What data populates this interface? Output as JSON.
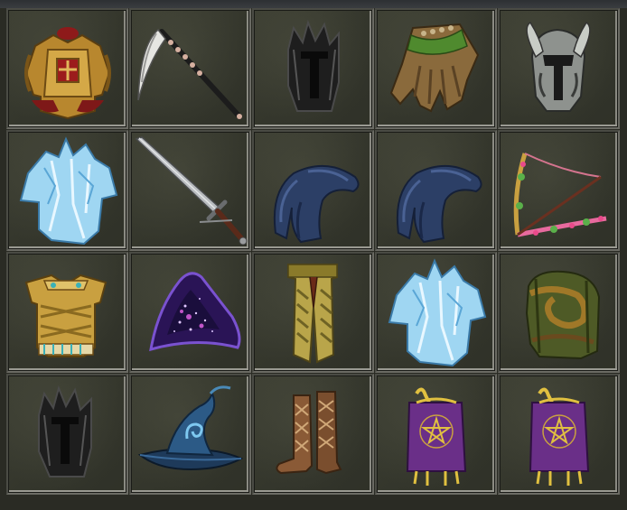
{
  "inventory": {
    "columns": 5,
    "rows": 4,
    "slots": [
      {
        "item": "golden-plate-armor-icon"
      },
      {
        "item": "scythe-icon"
      },
      {
        "item": "black-spiked-helm-icon"
      },
      {
        "item": "leather-gauntlets-icon"
      },
      {
        "item": "silver-winged-helm-icon"
      },
      {
        "item": "ice-crystal-robe-icon"
      },
      {
        "item": "longsword-icon"
      },
      {
        "item": "blue-fur-hood-icon"
      },
      {
        "item": "blue-fur-hood-icon"
      },
      {
        "item": "decorated-bow-icon"
      },
      {
        "item": "golden-bandage-armor-icon"
      },
      {
        "item": "starry-cloak-icon"
      },
      {
        "item": "golden-leg-armor-icon"
      },
      {
        "item": "ice-crystal-robe-icon"
      },
      {
        "item": "mossy-wrapped-armor-icon"
      },
      {
        "item": "black-spiked-helm-icon"
      },
      {
        "item": "wizard-hat-icon"
      },
      {
        "item": "leather-boots-icon"
      },
      {
        "item": "purple-pentagram-robe-icon"
      },
      {
        "item": "purple-pentagram-robe-icon"
      }
    ]
  },
  "colors": {
    "background": "#2a2b24",
    "slot_border_light": "#9a9a92",
    "slot_fill": "#36382e",
    "gold": "#c9a040",
    "ice": "#9fd6f2",
    "blue_fur": "#2c3f66",
    "purple": "#6a2f88"
  }
}
